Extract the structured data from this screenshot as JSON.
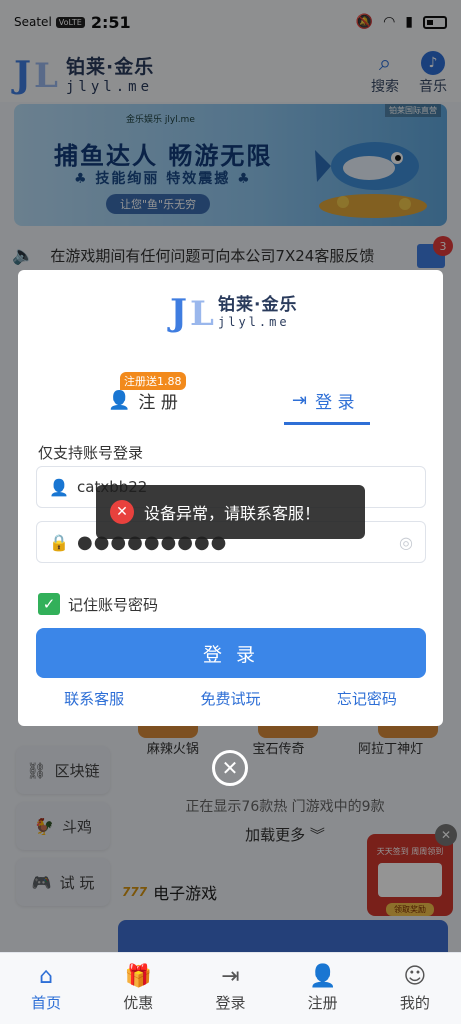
{
  "status_bar": {
    "carrier": "Seatel",
    "volte": "VoLTE",
    "time": "2:51"
  },
  "header": {
    "logo_cn": "铂莱·金乐",
    "logo_en": "jlyl.me",
    "search_label": "搜索",
    "music_label": "音乐"
  },
  "banner": {
    "brand": "金乐娱乐 jlyl.me",
    "title": "捕鱼达人 畅游无限",
    "subtitle": "♣ 技能绚丽 特效震撼 ♣",
    "slogan": "让您\"鱼\"乐无穷",
    "tag": "铂莱国际直营"
  },
  "notice": {
    "text": "在游戏期间有任何问题可向本公司7X24客服反馈",
    "badge": "3"
  },
  "sidebar": {
    "items": [
      {
        "label": "区块链",
        "icon": "blockchain-icon"
      },
      {
        "label": "斗鸡",
        "icon": "rooster-icon"
      },
      {
        "label": "试 玩",
        "icon": "gamepad-icon"
      }
    ]
  },
  "games": {
    "names": [
      "麻辣火锅",
      "宝石传奇",
      "阿拉丁神灯"
    ],
    "showing": "正在显示76款热 门游戏中的9款",
    "load_more": "加载更多"
  },
  "egame": {
    "icon_text": "777",
    "title": "电子游戏"
  },
  "promo": {
    "line1": "天天签到 周周领到",
    "claim": "领取奖励"
  },
  "tabbar": {
    "items": [
      {
        "label": "首页",
        "active": true
      },
      {
        "label": "优惠",
        "active": false
      },
      {
        "label": "登录",
        "active": false
      },
      {
        "label": "注册",
        "active": false
      },
      {
        "label": "我的",
        "active": false
      }
    ]
  },
  "modal": {
    "logo_cn": "铂莱·金乐",
    "logo_en": "jlyl.me",
    "register_badge": "注册送1.88",
    "register_tab": "注 册",
    "login_tab": "登 录",
    "subtitle": "仅支持账号登录",
    "username_value": "catxbb22",
    "password_value": "●●●●●●●●●",
    "remember_label": "记住账号密码",
    "submit_label": "登 录",
    "links": [
      "联系客服",
      "免费试玩",
      "忘记密码"
    ]
  },
  "toast": {
    "message": "设备异常，请联系客服！"
  },
  "colors": {
    "primary": "#3b86e8",
    "accent": "#2e6fd6",
    "error": "#e8413d",
    "success": "#32b05a"
  }
}
